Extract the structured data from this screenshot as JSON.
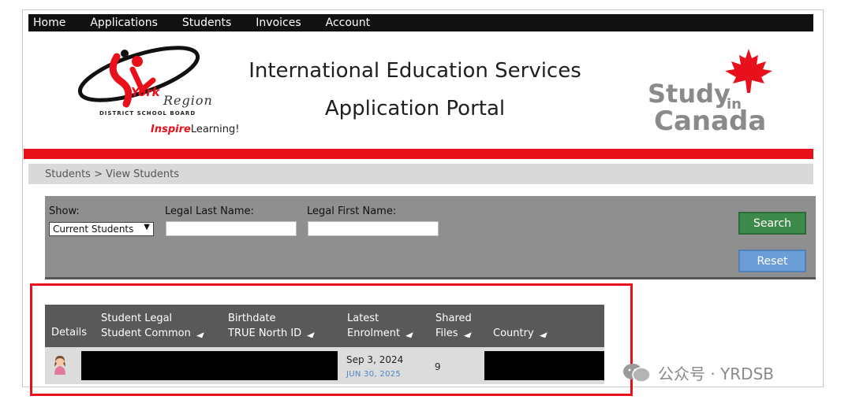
{
  "nav": {
    "items": [
      {
        "label": "Home"
      },
      {
        "label": "Applications"
      },
      {
        "label": "Students"
      },
      {
        "label": "Invoices"
      },
      {
        "label": "Account"
      }
    ]
  },
  "header": {
    "title_line1": "International Education Services",
    "title_line2": "Application Portal",
    "logo": {
      "york": "York",
      "region": "Region",
      "board": "DISTRICT SCHOOL BOARD",
      "tagline_bold": "Inspire",
      "tagline_rest": "Learning!"
    },
    "study_in_canada": {
      "study": "Study",
      "in": "in",
      "canada": "Canada"
    }
  },
  "breadcrumb": "Students > View Students",
  "filters": {
    "show_label": "Show:",
    "show_value": "Current Students",
    "last_name_label": "Legal Last Name:",
    "last_name_value": "",
    "first_name_label": "Legal First Name:",
    "first_name_value": "",
    "search_label": "Search",
    "reset_label": "Reset"
  },
  "table": {
    "headers": {
      "details": "Details",
      "student_line1": "Student Legal",
      "student_line2": "Student Common",
      "birthdate_line1": "Birthdate",
      "birthdate_line2": "TRUE North ID",
      "latest_line1": "Latest",
      "latest_line2": "Enrolment",
      "shared_line1": "Shared",
      "shared_line2": "Files",
      "country": "Country"
    },
    "rows": [
      {
        "enrolment_start": "Sep 3, 2024",
        "enrolment_end": "JUN 30, 2025",
        "shared_files": "9"
      }
    ]
  },
  "watermark": "公众号 · YRDSB",
  "colors": {
    "brand_red": "#e8101a",
    "nav_bg": "#111111",
    "search_green": "#3e8a4c",
    "reset_blue": "#6b9ed6"
  }
}
